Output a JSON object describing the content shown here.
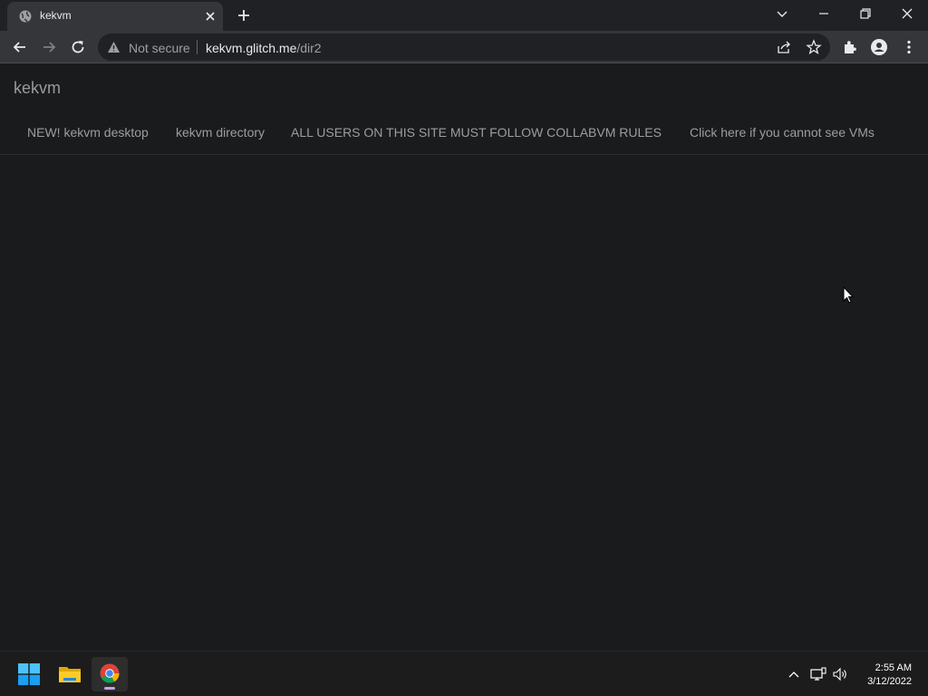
{
  "browser": {
    "tab_title": "kekvm",
    "security_label": "Not secure",
    "url_domain": "kekvm.glitch.me",
    "url_path": "/dir2"
  },
  "page": {
    "brand": "kekvm",
    "nav_links": [
      "NEW! kekvm desktop",
      "kekvm directory",
      "ALL USERS ON THIS SITE MUST FOLLOW COLLABVM RULES",
      "Click here if you cannot see VMs"
    ]
  },
  "taskbar": {
    "time": "2:55 AM",
    "date": "3/12/2022"
  },
  "colors": {
    "page_background": "#1a1b1d",
    "link_text": "#9d9d9d",
    "chrome_frame": "#202124",
    "chrome_toolbar": "#35363a"
  }
}
